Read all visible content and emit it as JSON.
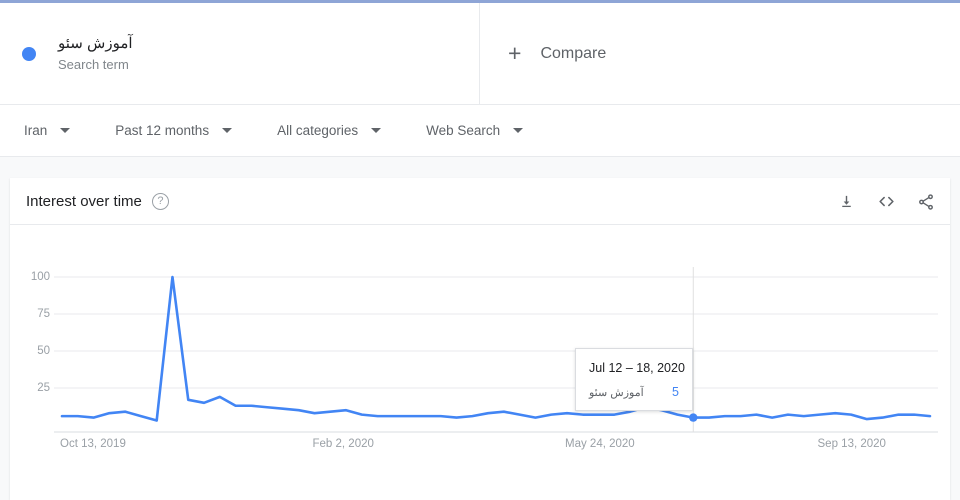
{
  "terms": [
    {
      "label": "آموزش سئو",
      "sub": "Search term",
      "color": "#4285f4",
      "dot_name": "series-color-dot"
    }
  ],
  "compare": {
    "plus": "+",
    "label": "Compare"
  },
  "filters": [
    {
      "label": "Iran"
    },
    {
      "label": "Past 12 months"
    },
    {
      "label": "All categories"
    },
    {
      "label": "Web Search"
    }
  ],
  "card": {
    "title": "Interest over time",
    "help_glyph": "?",
    "actions": [
      {
        "name": "download-icon"
      },
      {
        "name": "embed-code-icon"
      },
      {
        "name": "share-icon"
      }
    ]
  },
  "tooltip": {
    "date": "Jul 12 – 18, 2020",
    "term": "آموزش سئو",
    "value": "5"
  },
  "chart_data": {
    "type": "line",
    "title": "Interest over time",
    "xlabel": "",
    "ylabel": "",
    "ylim": [
      0,
      100
    ],
    "yticks": [
      100,
      75,
      50,
      25
    ],
    "grid": true,
    "legend": "none",
    "line_color": "#4285f4",
    "xticks": [
      "Oct 13, 2019",
      "Feb 2, 2020",
      "May 24, 2020",
      "Sep 13, 2020"
    ],
    "xtick_index": [
      0,
      16,
      32,
      48
    ],
    "highlight": {
      "index": 40,
      "label": "Jul 12 – 18, 2020",
      "value": 5
    },
    "series": [
      {
        "name": "آموزش سئو",
        "values": [
          6,
          6,
          5,
          8,
          9,
          6,
          3,
          100,
          17,
          15,
          19,
          13,
          13,
          12,
          11,
          10,
          8,
          9,
          10,
          7,
          6,
          6,
          6,
          6,
          6,
          5,
          6,
          8,
          9,
          7,
          5,
          7,
          8,
          7,
          7,
          7,
          9,
          12,
          10,
          7,
          5,
          5,
          6,
          6,
          7,
          5,
          7,
          6,
          7,
          8,
          7,
          4,
          5,
          7,
          7,
          6
        ]
      }
    ]
  }
}
